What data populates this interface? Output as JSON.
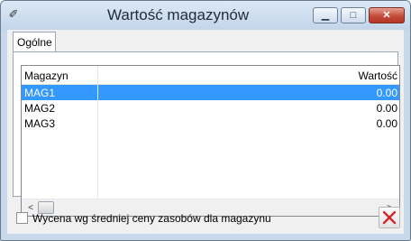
{
  "window": {
    "title": "Wartość magazynów",
    "minimize_glyph": "▁",
    "maximize_glyph": "□",
    "close_glyph": "✕"
  },
  "tabs": [
    {
      "label": "Ogólne",
      "active": true
    }
  ],
  "table": {
    "columns": [
      "Magazyn",
      "Wartość"
    ],
    "rows": [
      {
        "name": "MAG1",
        "value": "0.00",
        "selected": true
      },
      {
        "name": "MAG2",
        "value": "0.00",
        "selected": false
      },
      {
        "name": "MAG3",
        "value": "0.00",
        "selected": false
      }
    ]
  },
  "scrollbar": {
    "left_arrow": "<",
    "right_arrow": ">"
  },
  "footer": {
    "checkbox_label": "Wycena wg średniej ceny zasobów dla magazynu",
    "checkbox_checked": false,
    "close_icon": "red-x-icon"
  },
  "colors": {
    "selection": "#3399ff",
    "close_x": "#d7262a",
    "title_bar": "#c3d5ea"
  }
}
